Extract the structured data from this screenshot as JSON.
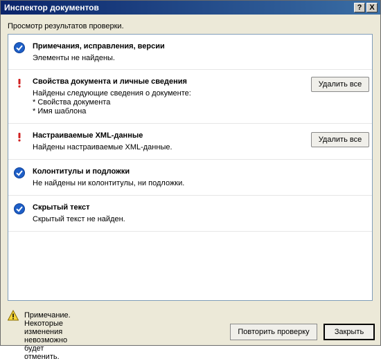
{
  "window": {
    "title": "Инспектор документов",
    "help_label": "?",
    "close_label": "X"
  },
  "subtitle": "Просмотр результатов проверки.",
  "items": [
    {
      "status": "ok",
      "heading": "Примечания, исправления, версии",
      "desc": [
        "Элементы не найдены."
      ],
      "action": ""
    },
    {
      "status": "issue",
      "heading": "Свойства документа и личные сведения",
      "desc": [
        "Найдены следующие сведения о документе:",
        "* Свойства документа",
        "* Имя шаблона"
      ],
      "action": "Удалить все"
    },
    {
      "status": "issue",
      "heading": "Настраиваемые XML-данные",
      "desc": [
        "Найдены настраиваемые XML-данные."
      ],
      "action": "Удалить все"
    },
    {
      "status": "ok",
      "heading": "Колонтитулы и подложки",
      "desc": [
        "Не найдены ни колонтитулы, ни подложки."
      ],
      "action": ""
    },
    {
      "status": "ok",
      "heading": "Скрытый текст",
      "desc": [
        "Скрытый текст не найден."
      ],
      "action": ""
    }
  ],
  "note": "Примечание. Некоторые изменения невозможно будет отменить.",
  "buttons": {
    "retry": "Повторить проверку",
    "close": "Закрыть"
  },
  "colors": {
    "titlebar": "#0a246a",
    "ok_icon": "#1e5fc7",
    "issue_icon": "#d02020"
  }
}
